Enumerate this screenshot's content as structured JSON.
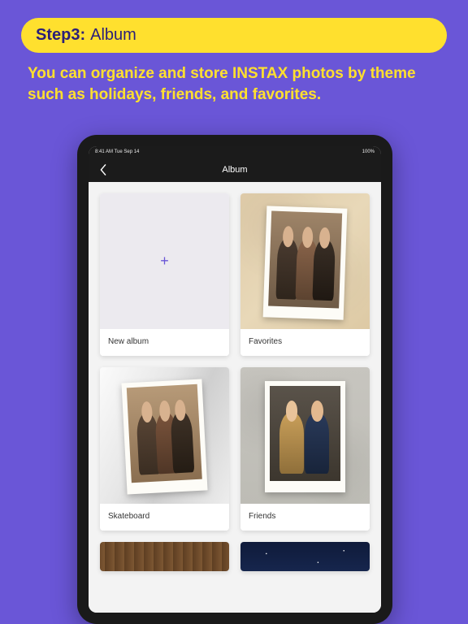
{
  "banner": {
    "step_number": "Step3:",
    "step_title": "Album"
  },
  "description": "You can organize and store INSTAX photos by theme such as holidays, friends, and favorites.",
  "device": {
    "status_time": "8:41 AM  Tue Sep 14",
    "status_battery": "100%",
    "nav_title": "Album",
    "albums": [
      {
        "label": "New album"
      },
      {
        "label": "Favorites"
      },
      {
        "label": "Skateboard"
      },
      {
        "label": "Friends"
      }
    ]
  }
}
